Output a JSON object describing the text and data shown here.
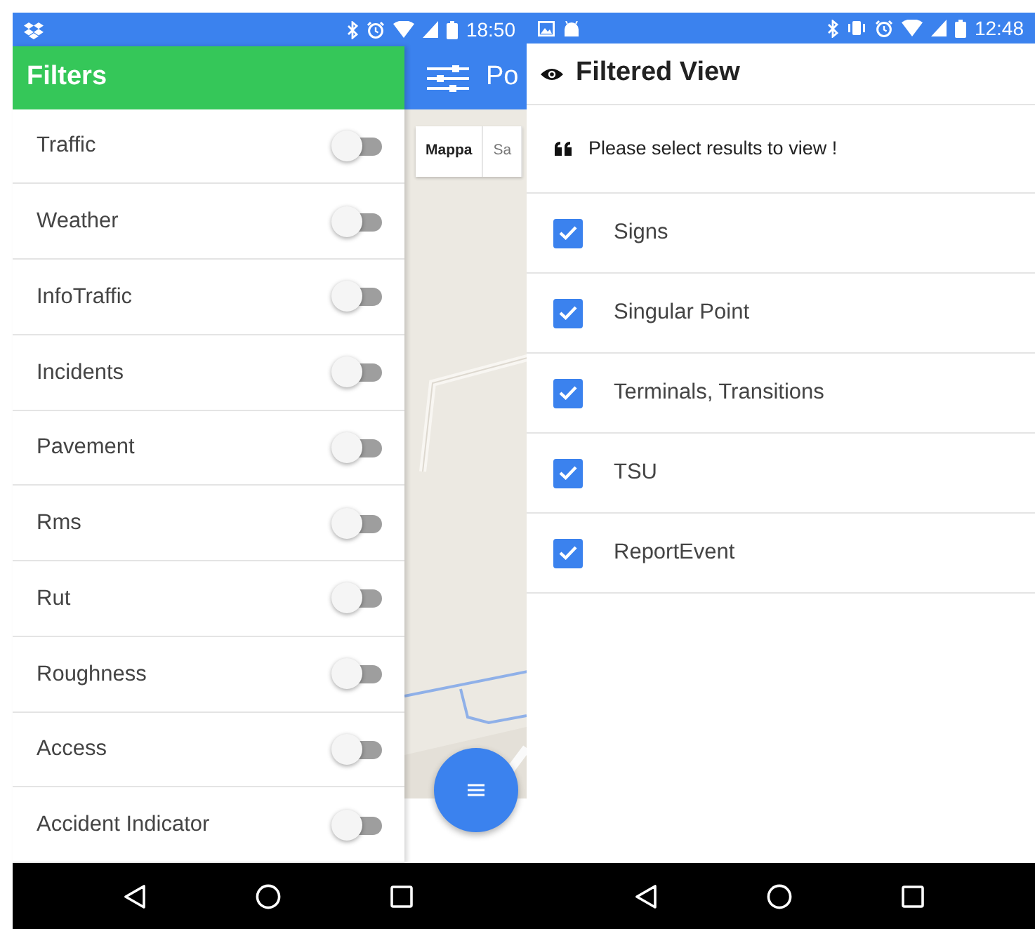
{
  "left_screen": {
    "status_bar": {
      "time": "18:50"
    },
    "drawer": {
      "title": "Filters",
      "items": [
        {
          "label": "Traffic",
          "on": false
        },
        {
          "label": "Weather",
          "on": false
        },
        {
          "label": "InfoTraffic",
          "on": false
        },
        {
          "label": "Incidents",
          "on": false
        },
        {
          "label": "Pavement",
          "on": false
        },
        {
          "label": "Rms",
          "on": false
        },
        {
          "label": "Rut",
          "on": false
        },
        {
          "label": "Roughness",
          "on": false
        },
        {
          "label": "Access",
          "on": false
        },
        {
          "label": "Accident Indicator",
          "on": false
        }
      ]
    },
    "map": {
      "title": "Po",
      "map_types": [
        {
          "label": "Mappa",
          "selected": true
        },
        {
          "label": "Sa",
          "selected": false
        }
      ]
    }
  },
  "right_screen": {
    "status_bar": {
      "time": "12:48"
    },
    "header": {
      "title": "Filtered View"
    },
    "message": "Please select results to view !",
    "options": [
      {
        "label": "Signs",
        "checked": true
      },
      {
        "label": "Singular Point",
        "checked": true
      },
      {
        "label": "Terminals, Transitions",
        "checked": true
      },
      {
        "label": "TSU",
        "checked": true
      },
      {
        "label": "ReportEvent",
        "checked": true
      }
    ]
  }
}
